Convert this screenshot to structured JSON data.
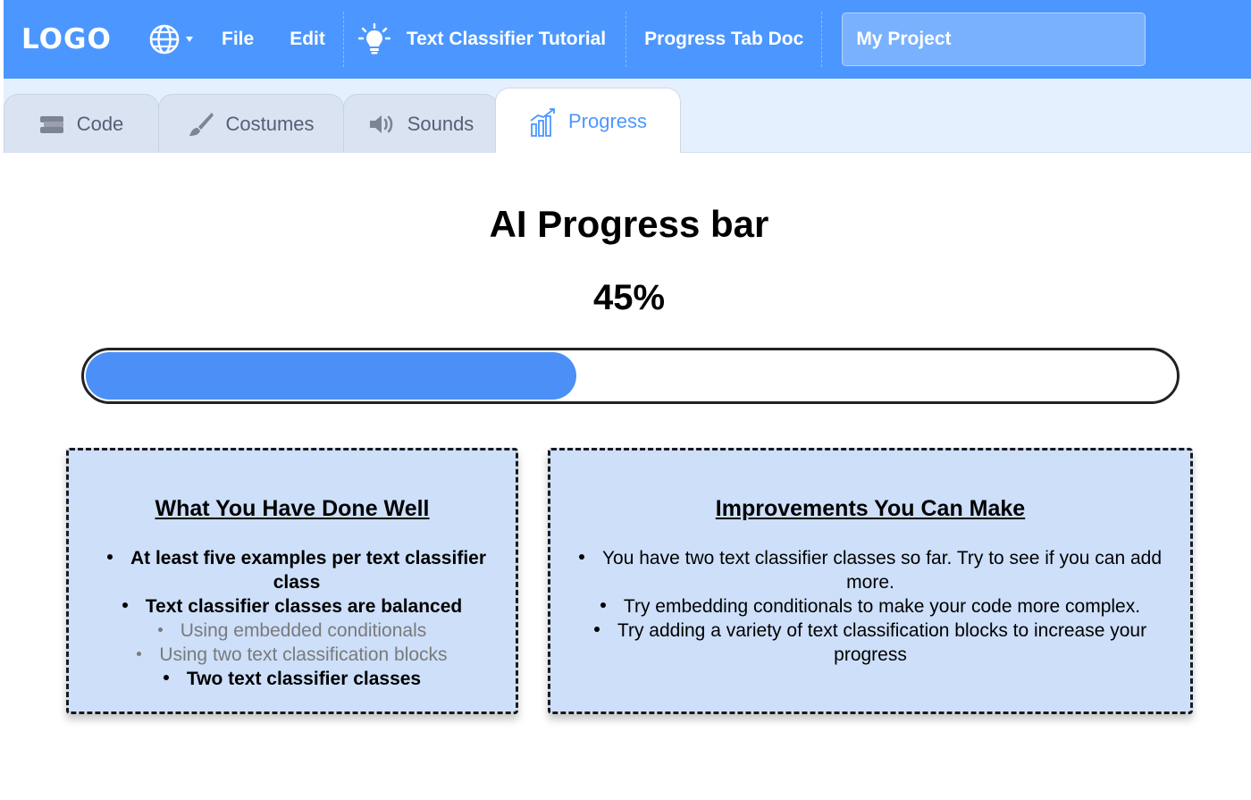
{
  "menubar": {
    "logo": "LOGO",
    "file": "File",
    "edit": "Edit",
    "tutorial": "Text Classifier Tutorial",
    "doc": "Progress Tab Doc",
    "project_title": "My Project",
    "accent_color": "#4c97ff"
  },
  "tabs": [
    {
      "label": "Code",
      "icon": "code-blocks-icon"
    },
    {
      "label": "Costumes",
      "icon": "paintbrush-icon"
    },
    {
      "label": "Sounds",
      "icon": "speaker-icon"
    },
    {
      "label": "Progress",
      "icon": "bar-chart-icon",
      "active": true
    }
  ],
  "progress": {
    "title": "AI Progress bar",
    "percent_label": "45%",
    "value": 45,
    "fill_color": "#4c8ff6"
  },
  "done_well": {
    "title": "What You Have Done Well",
    "items": [
      "At least five examples per text classifier class",
      "Text classifier classes are balanced",
      "Using embedded conditionals",
      "Using two text classification blocks",
      "Two text classifier classes"
    ]
  },
  "improvements": {
    "title": "Improvements You Can Make",
    "items": [
      "You have two text classifier classes so far. Try to see if you can add more.",
      "Try embedding conditionals to make your code more complex.",
      "Try adding a variety of text classification blocks to increase your progress"
    ]
  }
}
